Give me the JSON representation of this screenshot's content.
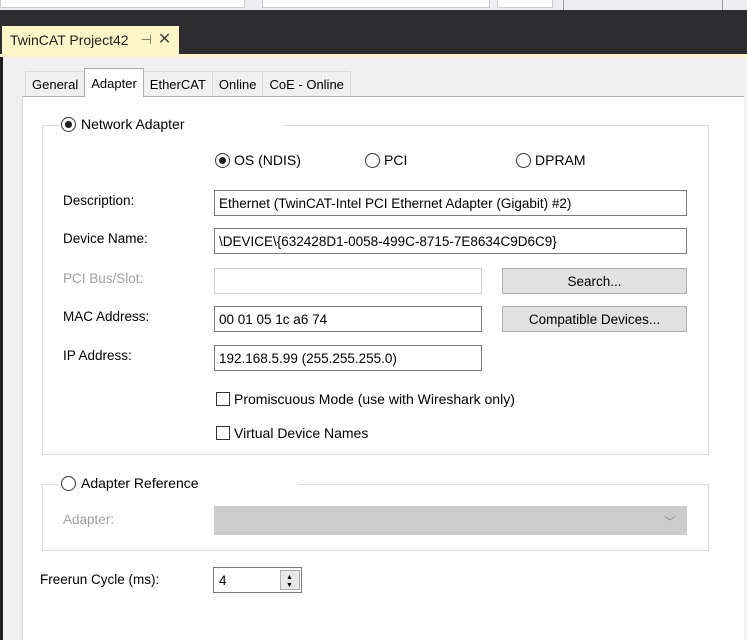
{
  "document_tab": {
    "title": "TwinCAT Project42",
    "pin_glyph": "⊣",
    "close_glyph": "✕"
  },
  "tabs": [
    {
      "label": "General",
      "active": false
    },
    {
      "label": "Adapter",
      "active": true
    },
    {
      "label": "EtherCAT",
      "active": false
    },
    {
      "label": "Online",
      "active": false
    },
    {
      "label": "CoE - Online",
      "active": false
    }
  ],
  "network_adapter": {
    "label": "Network Adapter",
    "selected": true,
    "modes": [
      {
        "label": "OS (NDIS)",
        "selected": true
      },
      {
        "label": "PCI",
        "selected": false
      },
      {
        "label": "DPRAM",
        "selected": false
      }
    ],
    "description": {
      "label": "Description:",
      "value": "Ethernet (TwinCAT-Intel PCI Ethernet Adapter (Gigabit) #2)"
    },
    "device_name": {
      "label": "Device Name:",
      "value": "\\DEVICE\\{632428D1-0058-499C-8715-7E8634C9D6C9}"
    },
    "pci_bus_slot": {
      "label": "PCI Bus/Slot:",
      "value": ""
    },
    "mac_address": {
      "label": "MAC Address:",
      "value": "00 01 05 1c a6 74"
    },
    "ip_address": {
      "label": "IP Address:",
      "value": "192.168.5.99 (255.255.255.0)"
    },
    "search_button": "Search...",
    "compatible_button": "Compatible Devices...",
    "promiscuous_mode": {
      "label": "Promiscuous Mode (use with Wireshark only)",
      "checked": false
    },
    "virtual_device_names": {
      "label": "Virtual Device Names",
      "checked": false
    }
  },
  "adapter_reference": {
    "label": "Adapter Reference",
    "selected": false,
    "adapter_label": "Adapter:",
    "adapter_value": ""
  },
  "freerun": {
    "label": "Freerun Cycle (ms):",
    "value": "4"
  },
  "colors": {
    "tab_highlight": "#fff6c8",
    "chrome_dark": "#2d2d30",
    "panel_bg": "#f0f0f0"
  }
}
